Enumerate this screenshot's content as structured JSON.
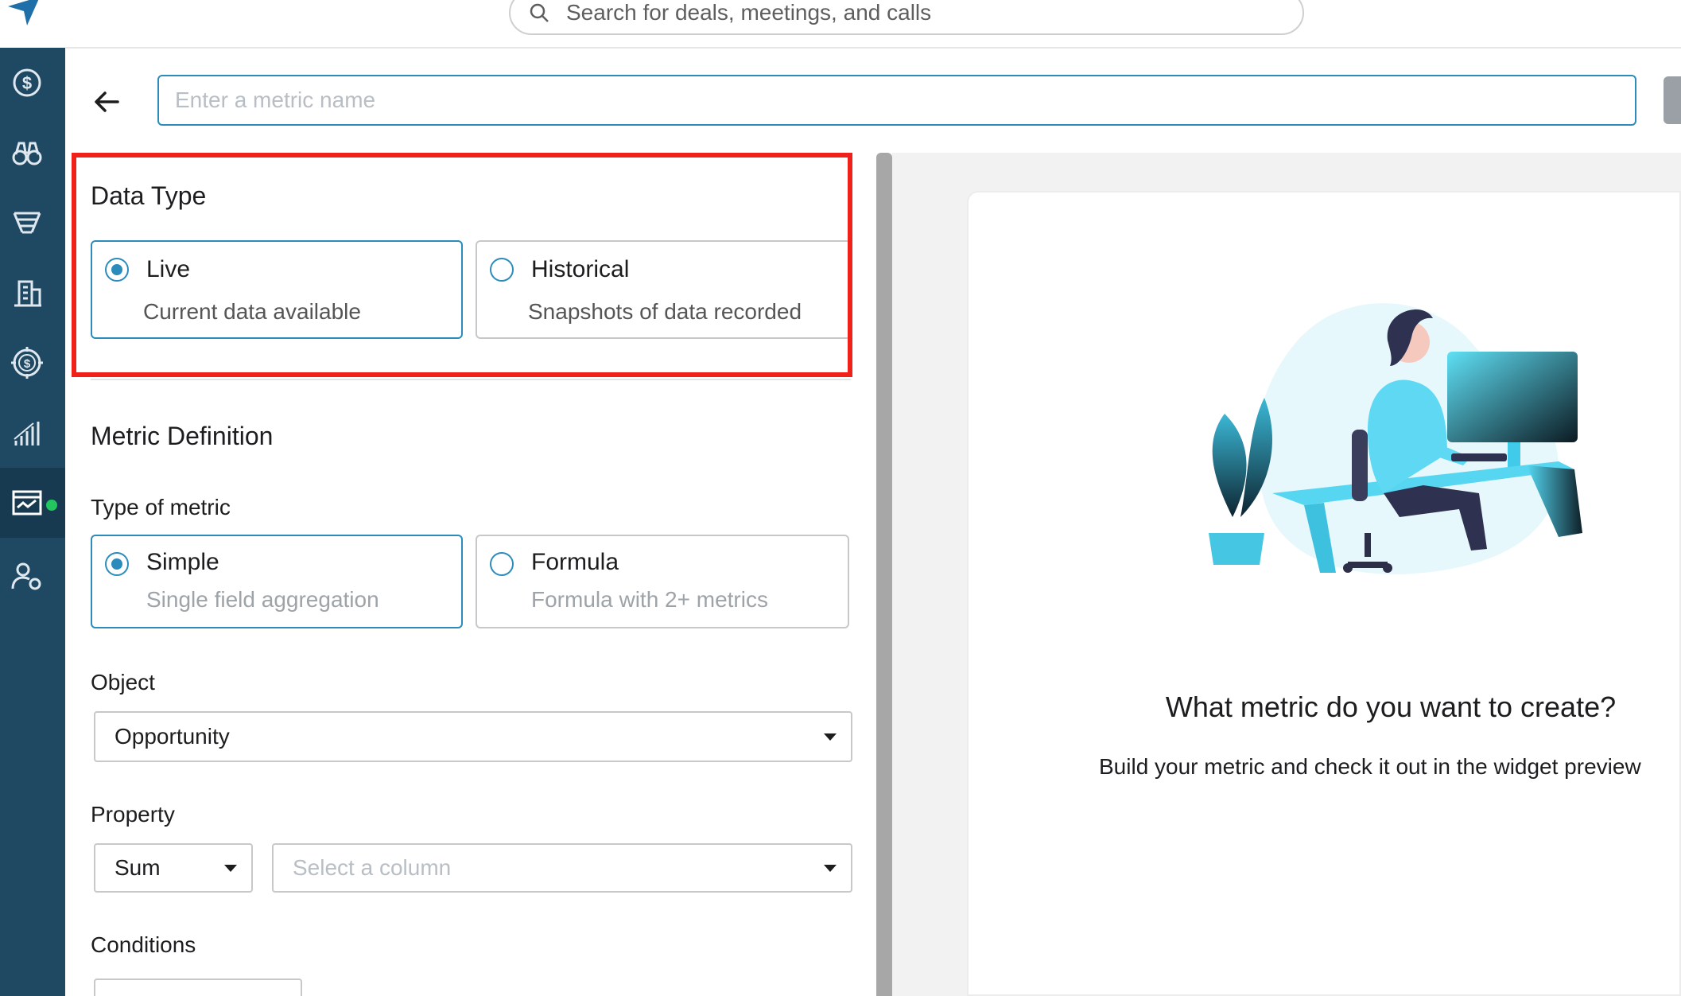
{
  "search": {
    "placeholder": "Search for deals, meetings, and calls"
  },
  "metric_name": {
    "placeholder": "Enter a metric name"
  },
  "sidebar": {
    "items": [
      {
        "icon": "dollar-circle-icon"
      },
      {
        "icon": "binoculars-icon"
      },
      {
        "icon": "funnel-icon"
      },
      {
        "icon": "building-icon"
      },
      {
        "icon": "target-dollar-icon"
      },
      {
        "icon": "bar-chart-icon"
      },
      {
        "icon": "dashboard-icon",
        "active": true
      },
      {
        "icon": "user-settings-icon"
      }
    ],
    "accent": "#22c55e"
  },
  "data_type": {
    "title": "Data Type",
    "options": [
      {
        "label": "Live",
        "description": "Current data available",
        "selected": true
      },
      {
        "label": "Historical",
        "description": "Snapshots of data recorded",
        "selected": false
      }
    ]
  },
  "metric_definition": {
    "title": "Metric Definition",
    "type_label": "Type of metric",
    "types": [
      {
        "label": "Simple",
        "description": "Single field aggregation",
        "selected": true
      },
      {
        "label": "Formula",
        "description": "Formula with 2+ metrics",
        "selected": false
      }
    ],
    "object_label": "Object",
    "object_value": "Opportunity",
    "property_label": "Property",
    "aggregation_value": "Sum",
    "column_placeholder": "Select a column",
    "conditions_label": "Conditions"
  },
  "preview": {
    "title": "What metric do you want to create?",
    "subtitle": "Build your metric and check it out in the widget preview"
  },
  "colors": {
    "primary": "#2b8cbc",
    "sidebar": "#1f4863",
    "highlight": "#f0201a"
  }
}
